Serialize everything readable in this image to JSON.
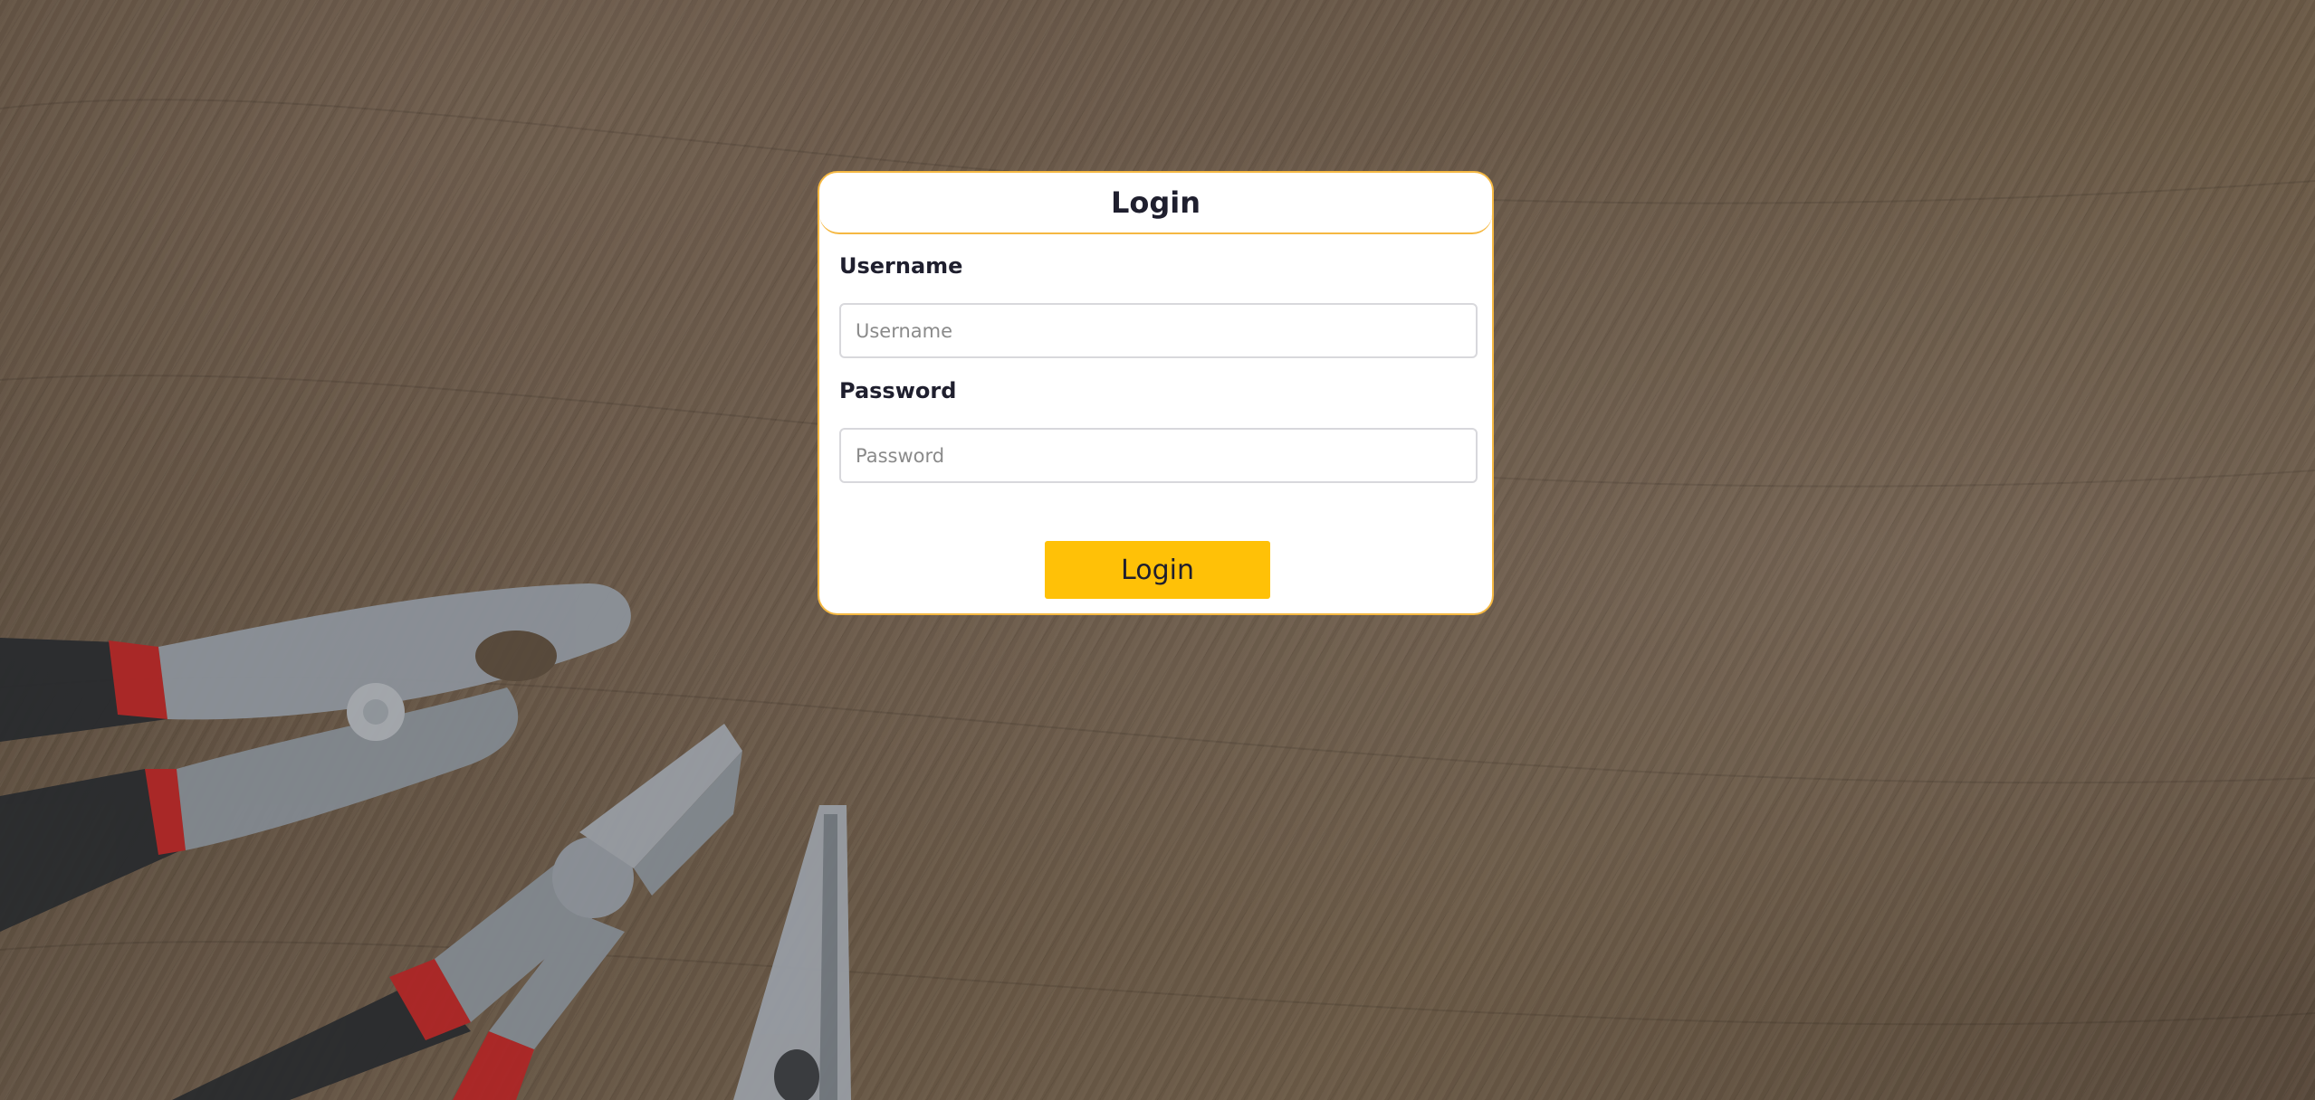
{
  "form": {
    "title": "Login",
    "username_label": "Username",
    "username_placeholder": "Username",
    "username_value": "",
    "password_label": "Password",
    "password_placeholder": "Password",
    "password_value": "",
    "submit_label": "Login"
  },
  "colors": {
    "accent": "#ffc107",
    "card_border": "#f5b842",
    "text": "#1f1f2e",
    "input_border": "#d8d8dc"
  },
  "icons": {
    "background": "pliers-tools-on-wood-image"
  }
}
